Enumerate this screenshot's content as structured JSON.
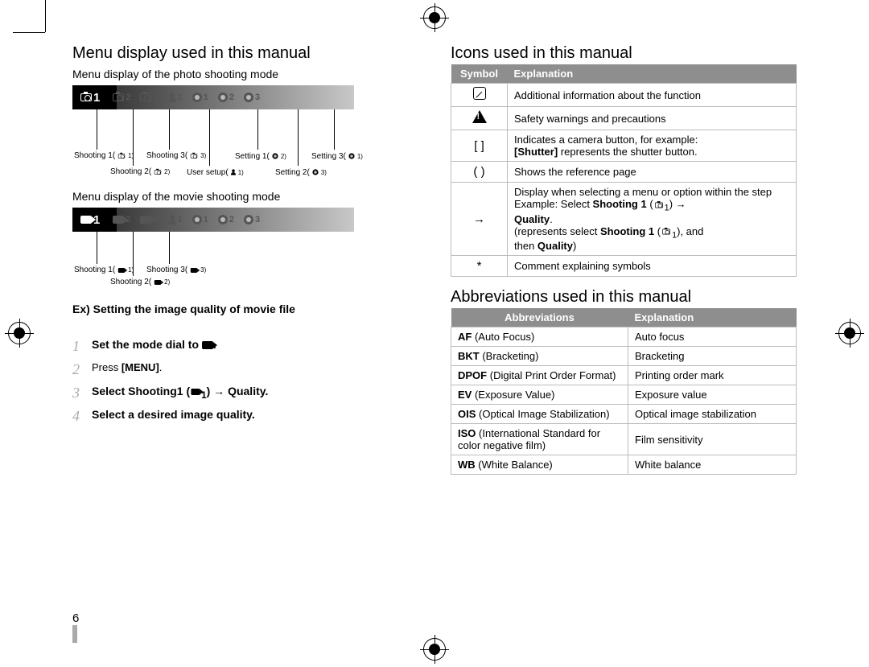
{
  "page_number": "6",
  "left": {
    "h2": "Menu display used in this manual",
    "h3a": "Menu display of the photo shooting mode",
    "photo_bar": [
      {
        "icon": "camera",
        "num": "1",
        "light": true
      },
      {
        "icon": "camera",
        "num": "2"
      },
      {
        "icon": "camera",
        "num": "3"
      },
      {
        "icon": "user",
        "num": "1"
      },
      {
        "icon": "gear",
        "num": "1"
      },
      {
        "icon": "gear",
        "num": "2"
      },
      {
        "icon": "gear",
        "num": "3"
      }
    ],
    "photo_callouts": [
      "Shooting 1",
      "Shooting 2",
      "Shooting 3",
      "User setup",
      "Setting 1",
      "Setting 2",
      "Setting 3"
    ],
    "h3b": "Menu display of the movie shooting mode",
    "movie_bar": [
      {
        "icon": "video",
        "num": "1",
        "light": true
      },
      {
        "icon": "video",
        "num": "2"
      },
      {
        "icon": "video",
        "num": "3"
      },
      {
        "icon": "user",
        "num": "1"
      },
      {
        "icon": "gear",
        "num": "1"
      },
      {
        "icon": "gear",
        "num": "2"
      },
      {
        "icon": "gear",
        "num": "3"
      }
    ],
    "movie_callouts": [
      "Shooting 1",
      "Shooting 2",
      "Shooting 3"
    ],
    "example_heading": "Ex) Setting the image quality of movie file",
    "steps": [
      {
        "n": "1",
        "text_a": "Set the mode dial to ",
        "icon": "video",
        "text_b": "."
      },
      {
        "n": "2",
        "text_a": "Press ",
        "bold": "[MENU]",
        "text_b": "."
      },
      {
        "n": "3",
        "text_a": "Select ",
        "bold": "Shooting1",
        "paren_icon": "video",
        "paren_sub": "1",
        "arrow": " → ",
        "bold2": "Quality."
      },
      {
        "n": "4",
        "text_a": "Select a desired image quality."
      }
    ]
  },
  "right": {
    "h2a": "Icons used in this manual",
    "icons_table": {
      "head": [
        "Symbol",
        "Explanation"
      ],
      "rows": [
        {
          "sym_type": "note",
          "text": "Additional information about the function"
        },
        {
          "sym_type": "warn",
          "text": "Safety warnings and precautions"
        },
        {
          "sym": "[  ]",
          "lines": [
            "Indicates a camera button, for example:",
            {
              "bold": "[Shutter]",
              "rest": " represents the shutter button."
            }
          ]
        },
        {
          "sym": "(  )",
          "text": "Shows the reference page"
        },
        {
          "sym": "→",
          "lines": [
            "Display when selecting a menu or option within the step",
            {
              "pre": "Example: Select ",
              "bold": "Shooting 1",
              "icon_sub": "1",
              "arrow": " → "
            },
            {
              "bold": "Quality",
              "rest": "."
            },
            {
              "pre": "(represents select ",
              "bold": "Shooting 1",
              "icon_sub": "1",
              "rest": ", and"
            },
            {
              "pre": "then ",
              "bold": "Quality",
              "rest": ")"
            }
          ]
        },
        {
          "sym": "*",
          "text": "Comment explaining symbols"
        }
      ]
    },
    "h2b": "Abbreviations used in this manual",
    "abbr_table": {
      "head": [
        "Abbreviations",
        "Explanation"
      ],
      "rows": [
        {
          "abbr": "AF",
          "full": " (Auto Focus)",
          "exp": "Auto focus"
        },
        {
          "abbr": "BKT",
          "full": " (Bracketing)",
          "exp": "Bracketing"
        },
        {
          "abbr": "DPOF",
          "full": " (Digital Print Order Format)",
          "exp": "Printing order mark"
        },
        {
          "abbr": "EV",
          "full": " (Exposure Value)",
          "exp": "Exposure value"
        },
        {
          "abbr": "OIS",
          "full": " (Optical  Image Stabilization)",
          "exp": "Optical image stabilization"
        },
        {
          "abbr": "ISO",
          "full": " (International Standard for color negative  film)",
          "exp": "Film sensitivity"
        },
        {
          "abbr": "WB",
          "full": " (White Balance)",
          "exp": "White balance"
        }
      ]
    }
  }
}
